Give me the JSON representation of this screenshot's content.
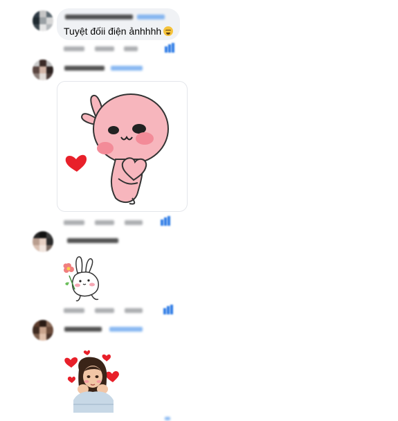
{
  "comments": [
    {
      "id": "c1",
      "message": "Tuyệt đốii điện ảnhhhh",
      "emoji_name": "grinning-squint-emoji",
      "author_visible": false,
      "action_texts_visible": false
    },
    {
      "id": "c2",
      "sticker_name": "pink-bunny-heart-sticker",
      "author_visible": false,
      "action_texts_visible": false
    },
    {
      "id": "c3",
      "sticker_name": "white-bunny-flower-sticker",
      "author_visible": false,
      "action_texts_visible": false
    },
    {
      "id": "c4",
      "sticker_name": "girl-hearts-sticker",
      "author_visible": false,
      "action_texts_visible": false
    }
  ],
  "colors": {
    "bubble_bg": "#f0f2f5",
    "card_border": "#e4e6eb",
    "link_blue": "#2d7be5",
    "heart_red": "#e8202a",
    "bunny_pink": "#f7b6bd"
  },
  "icons": [
    "reaction-icon",
    "heart-icon",
    "flower-icon"
  ]
}
